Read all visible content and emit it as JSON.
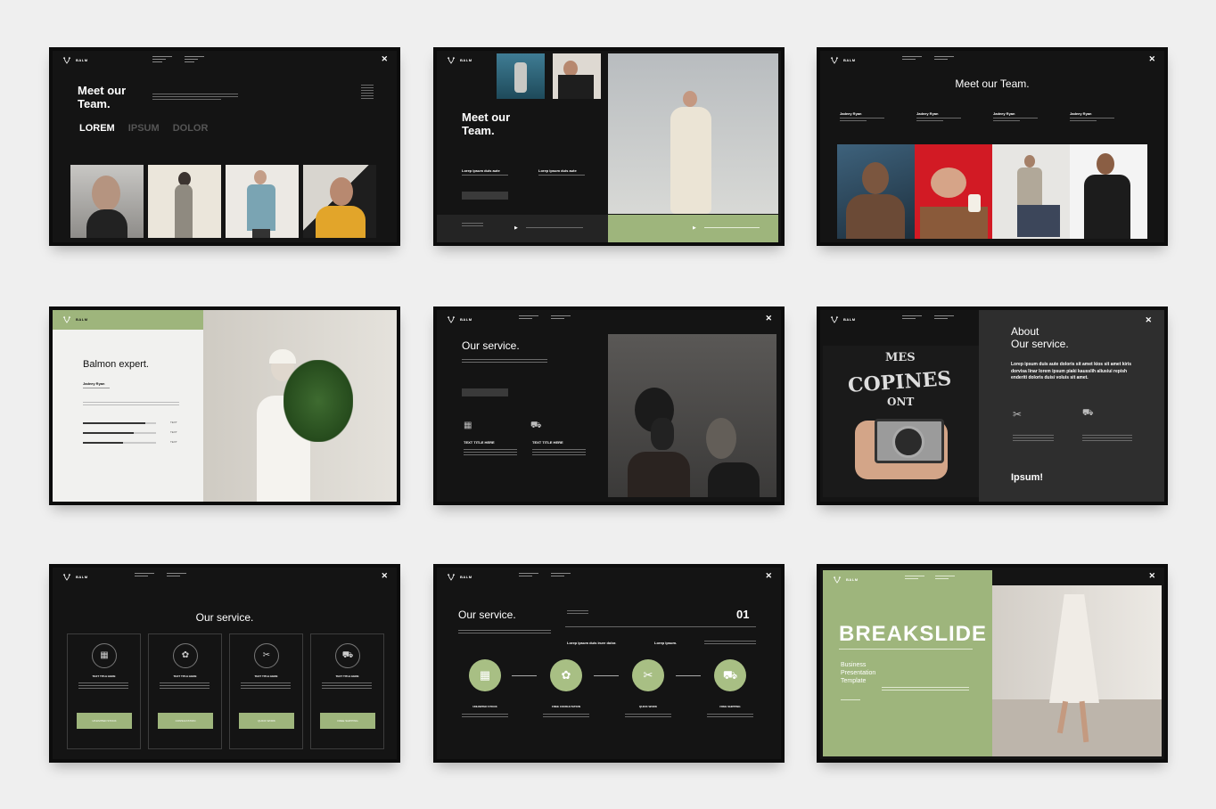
{
  "colors": {
    "accent": "#9eb57c",
    "dark": "#141414",
    "light": "#f1f1ef"
  },
  "brand": "BALM",
  "s1": {
    "title1": "Meet our",
    "title2": "Team.",
    "tab1": "LOREM",
    "tab2": "IPSUM",
    "tab3": "DOLOR"
  },
  "s2": {
    "title1": "Meet our",
    "title2": "Team.",
    "col1": "Lorep ipsum duis aute",
    "col2": "Lorep ipsum duis aute"
  },
  "s3": {
    "title": "Meet our Team.",
    "names": [
      "Jadeey Ryan",
      "Jadeey Ryan",
      "Jadeey Ryan",
      "Jadeey Ryan"
    ]
  },
  "s4": {
    "title": "Balmon expert.",
    "name": "Jadeey Ryan",
    "bar_label": "TEXT",
    "levels": [
      0.85,
      0.7,
      0.55
    ]
  },
  "s5": {
    "title": "Our service.",
    "items": [
      "TEXT TITLE HERE",
      "TEXT TITLE HERE"
    ]
  },
  "s6": {
    "title1": "About",
    "title2": "Our service.",
    "body": "Lorep ipsum duis aute doloris sit amet kios sit amet kiris dorvisa linar lorem ipsum piaki kausslih aliusiui repish enderiti doloris duisi voluis sit amet.",
    "footer": "Ipsum!",
    "shirt1": "MES",
    "shirt2": "COPINES",
    "shirt3": "ONT"
  },
  "s7": {
    "title": "Our service.",
    "cards": [
      {
        "label": "TEXT TITLE HERE",
        "button": "UNLIMITED STOCK"
      },
      {
        "label": "TEXT TITLE HERE",
        "button": "CONSULTATION"
      },
      {
        "label": "TEXT TITLE HERE",
        "button": "QUICK WORK"
      },
      {
        "label": "TEXT TITLE HERE",
        "button": "FREE SHIPPING"
      }
    ]
  },
  "s8": {
    "title": "Our service.",
    "number": "01",
    "sub1": "Lorep ipsum duis irure dolor.",
    "sub2": "Lorep ipsum.",
    "steps": [
      "UNLIMITED STOCK",
      "FREE CONSULTATION",
      "QUICK WORK",
      "FREE SHIPPING"
    ]
  },
  "s9": {
    "title": "BREAKSLIDE",
    "sub1": "Business",
    "sub2": "Presentation",
    "sub3": "Template"
  }
}
